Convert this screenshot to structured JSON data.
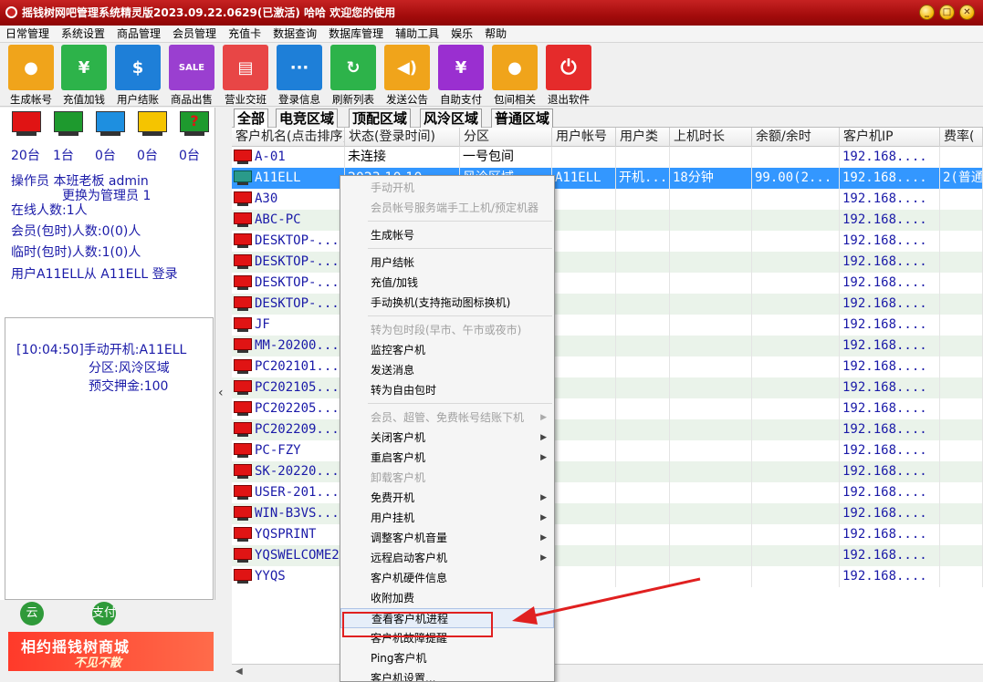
{
  "window": {
    "title": "摇钱树网吧管理系统精灵版2023.09.22.0629(已激活)   哈哈  欢迎您的使用"
  },
  "menu": [
    "日常管理",
    "系统设置",
    "商品管理",
    "会员管理",
    "充值卡",
    "数据查询",
    "数据库管理",
    "辅助工具",
    "娱乐",
    "帮助"
  ],
  "toolbar": [
    {
      "label": "生成帐号",
      "color": "#f0a41b",
      "icon": "user-icon"
    },
    {
      "label": "充值加钱",
      "color": "#2db34a",
      "icon": "moneybag-icon"
    },
    {
      "label": "用户结账",
      "color": "#1e7fd8",
      "icon": "dollar-icon"
    },
    {
      "label": "商品出售",
      "color": "#9a3fd0",
      "icon": "sale-tag-icon"
    },
    {
      "label": "营业交班",
      "color": "#e84646",
      "icon": "store-icon"
    },
    {
      "label": "登录信息",
      "color": "#1e7fd8",
      "icon": "chat-icon"
    },
    {
      "label": "刷新列表",
      "color": "#2db34a",
      "icon": "refresh-icon"
    },
    {
      "label": "发送公告",
      "color": "#f0a41b",
      "icon": "megaphone-icon"
    },
    {
      "label": "自助支付",
      "color": "#9a2fd0",
      "icon": "yen-icon"
    },
    {
      "label": "包间相关",
      "color": "#f0a41b",
      "icon": "user-icon"
    },
    {
      "label": "退出软件",
      "color": "#e52b2b",
      "icon": "power-icon"
    }
  ],
  "status_monitors": [
    {
      "color": "#e01414",
      "count": "20台"
    },
    {
      "color": "#1e9a2e",
      "count": "1台"
    },
    {
      "color": "#1e8fe0",
      "count": "0台"
    },
    {
      "color": "#f5c400",
      "count": "0台"
    },
    {
      "color": "#1e9a2e",
      "count": "0台"
    }
  ],
  "info": {
    "operator": "操作员 本班老板 admin",
    "switch_admin": "更换为管理员 1",
    "online": "在线人数:1人",
    "member": "会员(包时)人数:0(0)人",
    "temp": "临时(包时)人数:1(0)人",
    "login_msg": "用户A11ELL从 A11ELL 登录"
  },
  "log": {
    "line1": "[10:04:50]手动开机:A11ELL",
    "line2": "分区:风泠区域",
    "line3": "预交押金:100"
  },
  "bottom_buttons": {
    "cloud": "云",
    "pay": "支付"
  },
  "banner": {
    "line1": "相约摇钱树商城",
    "line2": "不见不散"
  },
  "tabs": [
    "全部",
    "电竞区域",
    "顶配区域",
    "风泠区域",
    "普通区域"
  ],
  "columns": [
    "客户机名(点击排序)",
    "状态(登录时间)",
    "分区",
    "用户帐号",
    "用户类",
    "上机时长",
    "余额/余时",
    "客户机IP",
    "费率("
  ],
  "rows": [
    {
      "name": "A-01",
      "status": "未连接",
      "zone": "一号包间",
      "account": "",
      "utype": "",
      "dur": "",
      "bal": "",
      "ip": "192.168....",
      "rate": ""
    },
    {
      "name": "A11ELL",
      "status": "2023-10-10",
      "zone": "风泠区域",
      "account": "A11ELL",
      "utype": "开机...",
      "dur": "18分钟",
      "bal": "99.00(2...",
      "ip": "192.168....",
      "rate": "2(普通"
    },
    {
      "name": "A30",
      "ip": "192.168...."
    },
    {
      "name": "ABC-PC",
      "ip": "192.168...."
    },
    {
      "name": "DESKTOP-...",
      "ip": "192.168...."
    },
    {
      "name": "DESKTOP-...",
      "ip": "192.168...."
    },
    {
      "name": "DESKTOP-...",
      "ip": "192.168...."
    },
    {
      "name": "DESKTOP-...",
      "ip": "192.168...."
    },
    {
      "name": "JF",
      "ip": "192.168...."
    },
    {
      "name": "MM-20200...",
      "ip": "192.168...."
    },
    {
      "name": "PC202101...",
      "ip": "192.168...."
    },
    {
      "name": "PC202105...",
      "ip": "192.168...."
    },
    {
      "name": "PC202205...",
      "ip": "192.168...."
    },
    {
      "name": "PC202209...",
      "ip": "192.168...."
    },
    {
      "name": "PC-FZY",
      "ip": "192.168...."
    },
    {
      "name": "SK-20220...",
      "ip": "192.168...."
    },
    {
      "name": "USER-201...",
      "ip": "192.168...."
    },
    {
      "name": "WIN-B3VS...",
      "ip": "192.168...."
    },
    {
      "name": "YQSPRINT",
      "ip": "192.168...."
    },
    {
      "name": "YQSWELCOME2",
      "ip": "192.168...."
    },
    {
      "name": "YYQS",
      "ip": "192.168...."
    }
  ],
  "context_menu": [
    {
      "label": "手动开机",
      "disabled": true
    },
    {
      "label": "会员帐号服务端手工上机/预定机器",
      "disabled": true
    },
    {
      "sep": true
    },
    {
      "label": "生成帐号"
    },
    {
      "sep": true
    },
    {
      "label": "用户结帐"
    },
    {
      "label": "充值/加钱"
    },
    {
      "label": "手动换机(支持拖动图标换机)"
    },
    {
      "sep": true
    },
    {
      "label": "转为包时段(早市、午市或夜市)",
      "disabled": true
    },
    {
      "label": "监控客户机"
    },
    {
      "label": "发送消息"
    },
    {
      "label": "转为自由包时"
    },
    {
      "sep": true
    },
    {
      "label": "会员、超管、免费帐号结账下机",
      "disabled": true,
      "sub": true
    },
    {
      "label": "关闭客户机",
      "sub": true
    },
    {
      "label": "重启客户机",
      "sub": true
    },
    {
      "label": "卸载客户机",
      "disabled": true
    },
    {
      "label": "免费开机",
      "sub": true
    },
    {
      "label": "用户挂机",
      "sub": true
    },
    {
      "label": "调整客户机音量",
      "sub": true
    },
    {
      "label": "远程启动客户机",
      "sub": true
    },
    {
      "label": "客户机硬件信息"
    },
    {
      "label": "收附加费"
    },
    {
      "label": "查看客户机进程",
      "highlight": true
    },
    {
      "label": "客户机故障提醒"
    },
    {
      "label": "Ping客户机"
    },
    {
      "label": "客户机设置..."
    }
  ]
}
